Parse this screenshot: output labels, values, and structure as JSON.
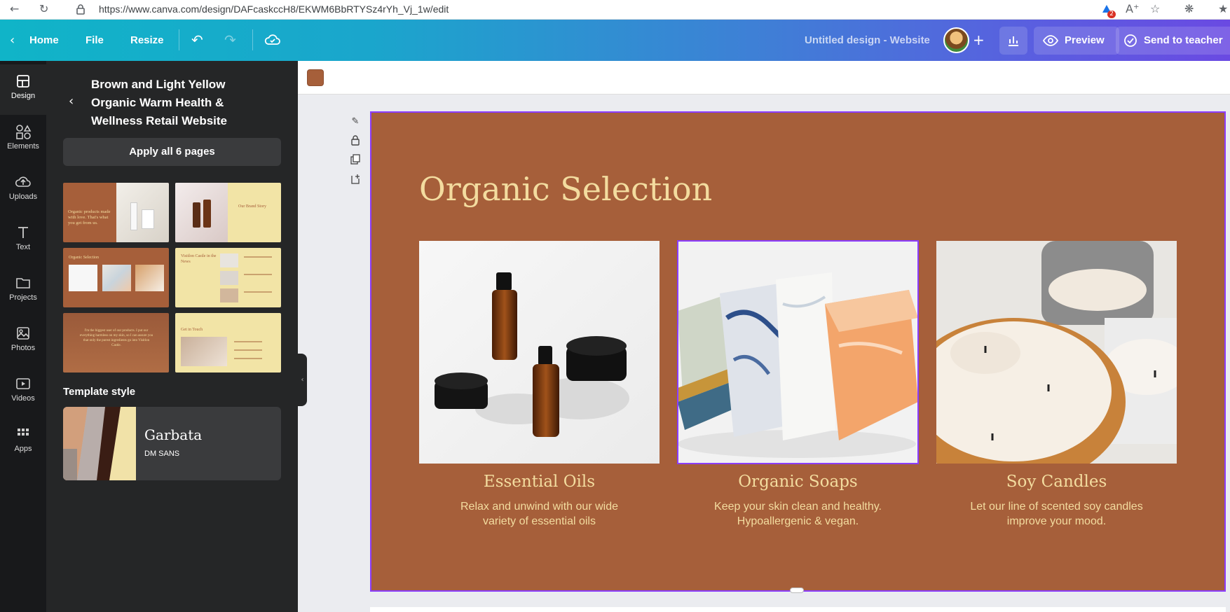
{
  "browser": {
    "url": "https://www.canva.com/design/DAFcaskccH8/EKWM6BbRTYSz4rYh_Vj_1w/edit",
    "extension_badge": "2"
  },
  "topbar": {
    "home": "Home",
    "file": "File",
    "resize": "Resize",
    "design_title": "Untitled design - Website",
    "preview": "Preview",
    "send": "Send to teacher"
  },
  "rail": {
    "items": [
      {
        "label": "Design",
        "icon": "layout-icon"
      },
      {
        "label": "Elements",
        "icon": "shapes-icon"
      },
      {
        "label": "Uploads",
        "icon": "cloud-upload-icon"
      },
      {
        "label": "Text",
        "icon": "text-icon"
      },
      {
        "label": "Projects",
        "icon": "folder-icon"
      },
      {
        "label": "Photos",
        "icon": "image-icon"
      },
      {
        "label": "Videos",
        "icon": "video-icon"
      },
      {
        "label": "Apps",
        "icon": "apps-grid-icon"
      }
    ]
  },
  "panel": {
    "template_title": "Brown and Light Yellow Organic Warm Health & Wellness Retail Website",
    "apply_button": "Apply all 6 pages",
    "thumbnails": [
      {
        "text": "Organic products made with love. That's what you get from us."
      },
      {
        "text": "Our Brand Story"
      },
      {
        "text": "Organic Selection"
      },
      {
        "text": "Visitlon Castle in the News"
      },
      {
        "text": "I'm the biggest user of our products. I put our everything harmless on my skin, so I can assure you that only the purest ingredients go into Visitlon Castle."
      },
      {
        "text": "Get in Touch"
      }
    ],
    "style_section": "Template style",
    "style_name": "Garbata",
    "style_font": "DM SANS"
  },
  "canvas": {
    "swatch_color": "#a65f3a",
    "page_bg": "#a65f3a",
    "accent_text_color": "#f3dc9f",
    "selection_color": "#8b3dff",
    "heading": "Organic Selection",
    "cards": [
      {
        "title": "Essential Oils",
        "line1": "Relax and unwind with our wide",
        "line2": "variety of essential oils"
      },
      {
        "title": "Organic Soaps",
        "line1": "Keep your skin clean and healthy.",
        "line2": "Hypoallergenic & vegan."
      },
      {
        "title": "Soy Candles",
        "line1": "Let our line of scented soy candles",
        "line2": "improve your mood."
      }
    ]
  }
}
